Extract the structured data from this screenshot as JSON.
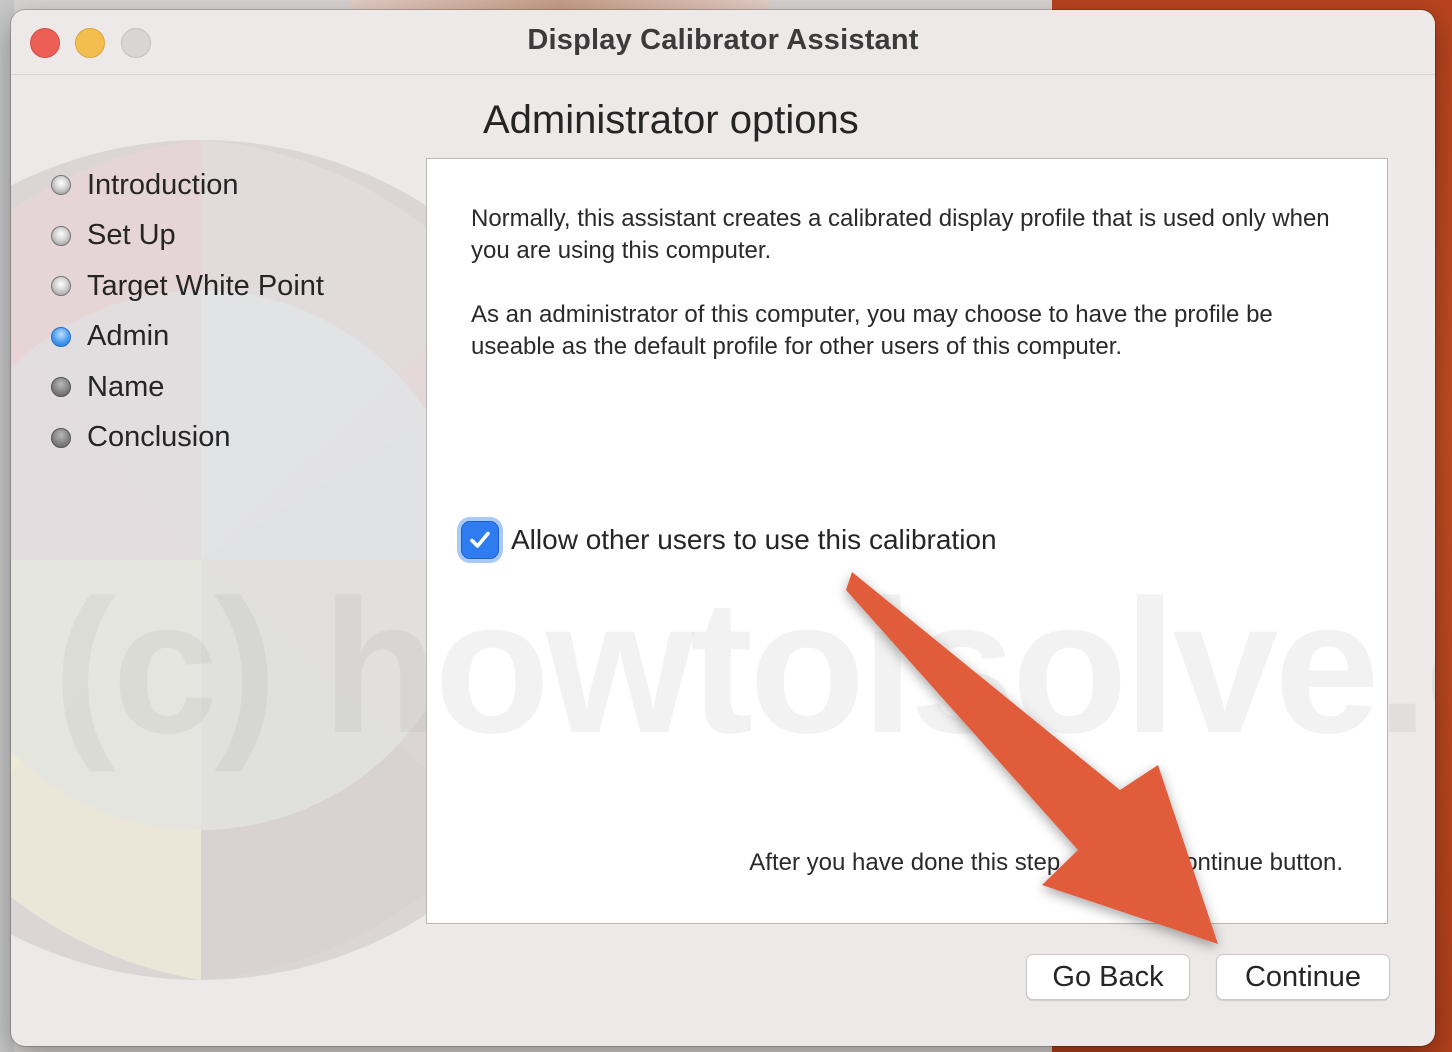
{
  "window": {
    "title": "Display Calibrator Assistant"
  },
  "sidebar": {
    "steps": [
      {
        "label": "Introduction",
        "state": "done"
      },
      {
        "label": "Set Up",
        "state": "done"
      },
      {
        "label": "Target White Point",
        "state": "done"
      },
      {
        "label": "Admin",
        "state": "current"
      },
      {
        "label": "Name",
        "state": "todo"
      },
      {
        "label": "Conclusion",
        "state": "todo"
      }
    ]
  },
  "main": {
    "title": "Administrator options",
    "paragraph1": "Normally, this assistant creates a calibrated display profile that is used only when you are using this computer.",
    "paragraph2": "As an administrator of this computer, you may choose to have the profile be useable as the default profile for other users of this computer.",
    "checkbox": {
      "label": "Allow other users to use this calibration",
      "checked": true
    },
    "footer_note": "After you have done this step, click the Continue button."
  },
  "buttons": {
    "back_label": "Go Back",
    "continue_label": "Continue"
  },
  "watermark": "(c) howtoisolve.com",
  "colors": {
    "accent": "#2f7bf0",
    "close": "#ec5f57",
    "minimize": "#f4be4f",
    "annotation_arrow": "#e15b3a"
  }
}
